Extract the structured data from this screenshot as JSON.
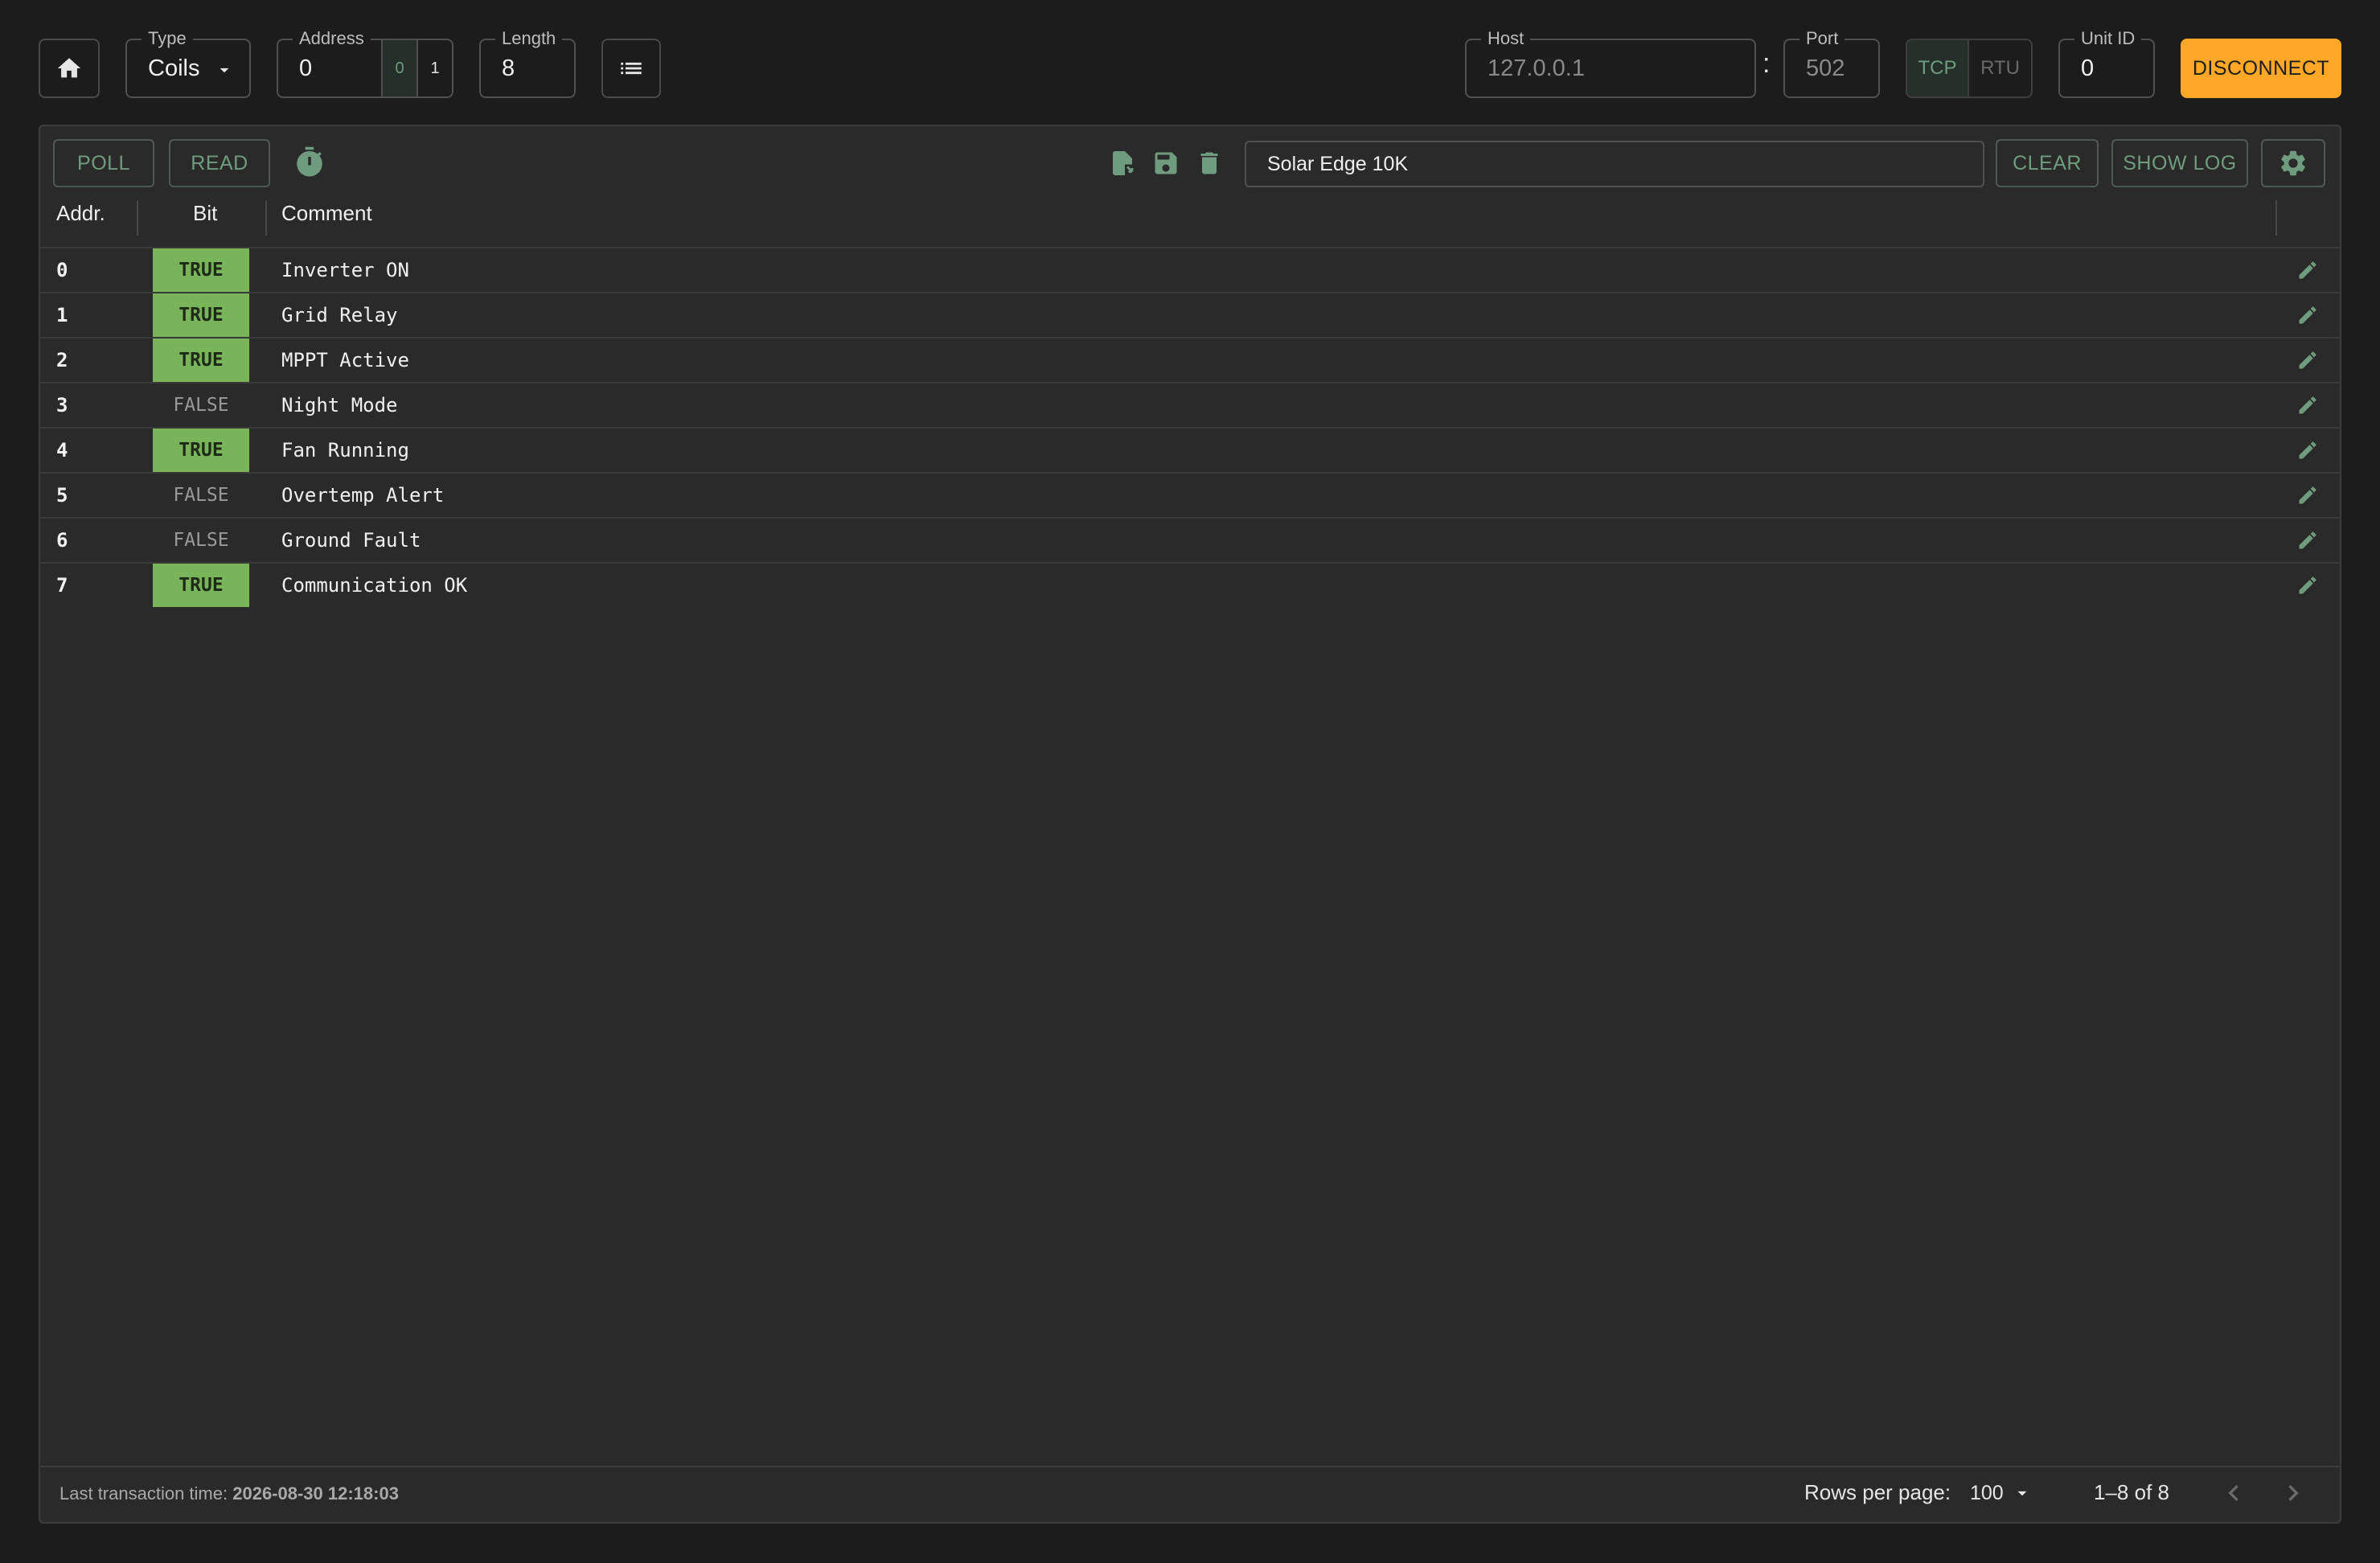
{
  "toolbar": {
    "type_label": "Type",
    "type_value": "Coils",
    "address_label": "Address",
    "address_value": "0",
    "address_base_options": [
      "0",
      "1"
    ],
    "length_label": "Length",
    "length_value": "8",
    "host_label": "Host",
    "host_value": "127.0.0.1",
    "separator": ":",
    "port_label": "Port",
    "port_value": "502",
    "protocols": [
      "TCP",
      "RTU"
    ],
    "unit_label": "Unit ID",
    "unit_value": "0",
    "disconnect_label": "DISCONNECT"
  },
  "panel": {
    "poll_label": "POLL",
    "read_label": "READ",
    "config_name": "Solar Edge 10K",
    "clear_label": "CLEAR",
    "show_log_label": "SHOW LOG"
  },
  "table": {
    "headers": {
      "addr": "Addr.",
      "bit": "Bit",
      "comment": "Comment"
    },
    "rows": [
      {
        "addr": "0",
        "bit": "TRUE",
        "comment": "Inverter ON"
      },
      {
        "addr": "1",
        "bit": "TRUE",
        "comment": "Grid Relay"
      },
      {
        "addr": "2",
        "bit": "TRUE",
        "comment": "MPPT Active"
      },
      {
        "addr": "3",
        "bit": "FALSE",
        "comment": "Night Mode"
      },
      {
        "addr": "4",
        "bit": "TRUE",
        "comment": "Fan Running"
      },
      {
        "addr": "5",
        "bit": "FALSE",
        "comment": "Overtemp Alert"
      },
      {
        "addr": "6",
        "bit": "FALSE",
        "comment": "Ground Fault"
      },
      {
        "addr": "7",
        "bit": "TRUE",
        "comment": "Communication OK"
      }
    ]
  },
  "footer": {
    "last_transaction_label": "Last transaction time:",
    "last_transaction_value": "2026-08-30 12:18:03",
    "rows_per_page_label": "Rows per page:",
    "rows_per_page_value": "100",
    "range_text": "1–8 of 8"
  },
  "colors": {
    "accent_orange": "#ffa726",
    "true_green": "#79b45a",
    "icon_green": "#6f9c7e"
  },
  "icons": [
    "home-icon",
    "chevron-down-icon",
    "list-icon",
    "timer-icon",
    "file-import-icon",
    "save-icon",
    "delete-icon",
    "gear-icon",
    "pencil-icon",
    "chevron-left-icon",
    "chevron-right-icon"
  ]
}
